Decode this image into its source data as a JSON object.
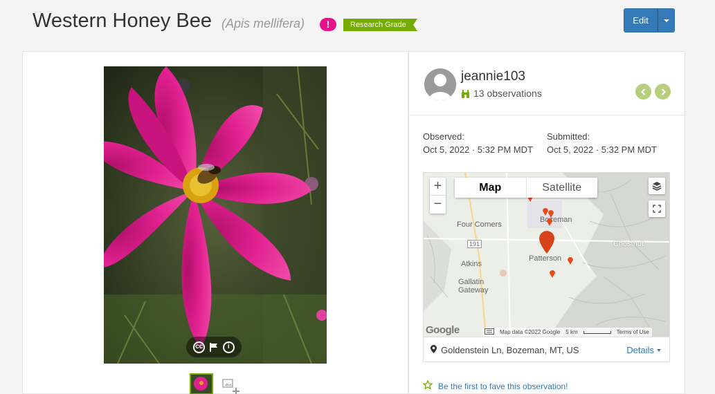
{
  "header": {
    "common_name": "Western Honey Bee",
    "scientific_name": "(Apis mellifera)",
    "alert_icon": "exclamation-icon",
    "quality_grade": "Research Grade",
    "edit_label": "Edit"
  },
  "photo": {
    "controls": [
      "cc-license-icon",
      "flag-icon",
      "info-icon"
    ],
    "thumb_count": 1,
    "cc_label": "cc",
    "info_label": "i"
  },
  "user": {
    "username": "jeannie103",
    "observations": "13 observations"
  },
  "dates": {
    "observed_label": "Observed:",
    "observed_value": "Oct 5, 2022 · 5:32 PM MDT",
    "submitted_label": "Submitted:",
    "submitted_value": "Oct 5, 2022 · 5:32 PM MDT"
  },
  "map": {
    "tabs": [
      "Map",
      "Satellite"
    ],
    "active_tab": "Map",
    "zoom_in": "+",
    "zoom_out": "−",
    "places": [
      "Four Corners",
      "Bozeman",
      "Chestnut",
      "Patterson",
      "Atkins",
      "Gallatin Gateway"
    ],
    "route_label": "191",
    "google": "Google",
    "attribution": "Map data ©2022 Google",
    "scale": "5 km",
    "terms": "Terms of Use"
  },
  "location": {
    "place": "Goldenstein Ln, Bozeman, MT, US",
    "details_label": "Details"
  },
  "fave": {
    "label": "Be the first to fave this observation!"
  },
  "colors": {
    "accent_green": "#74ac00",
    "link_blue": "#337ab7",
    "alert_pink": "#e6128b",
    "nav_green": "#b7cf7d"
  }
}
